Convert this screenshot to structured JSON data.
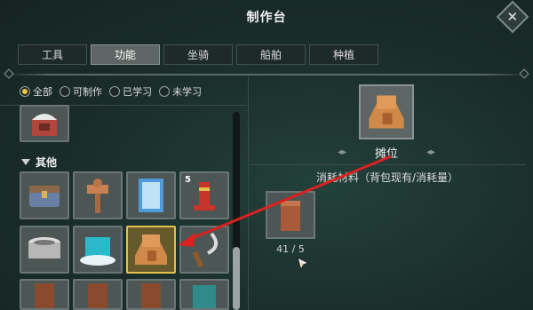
{
  "window": {
    "title": "制作台"
  },
  "tabs": [
    {
      "label": "工具",
      "active": false
    },
    {
      "label": "功能",
      "active": true
    },
    {
      "label": "坐骑",
      "active": false
    },
    {
      "label": "船舶",
      "active": false
    },
    {
      "label": "种植",
      "active": false
    }
  ],
  "filters": [
    {
      "label": "全部",
      "selected": true
    },
    {
      "label": "可制作",
      "selected": false
    },
    {
      "label": "已学习",
      "selected": false
    },
    {
      "label": "未学习",
      "selected": false
    }
  ],
  "category": {
    "label": "其他"
  },
  "grid": {
    "row2_slot4_count": "5"
  },
  "detail": {
    "item_name": "摊位",
    "materials_label": "消耗材料（背包现有/消耗量）",
    "material_count": "41 / 5"
  },
  "colors": {
    "accent": "#e3c14f",
    "annotation_arrow": "#d8221f"
  }
}
